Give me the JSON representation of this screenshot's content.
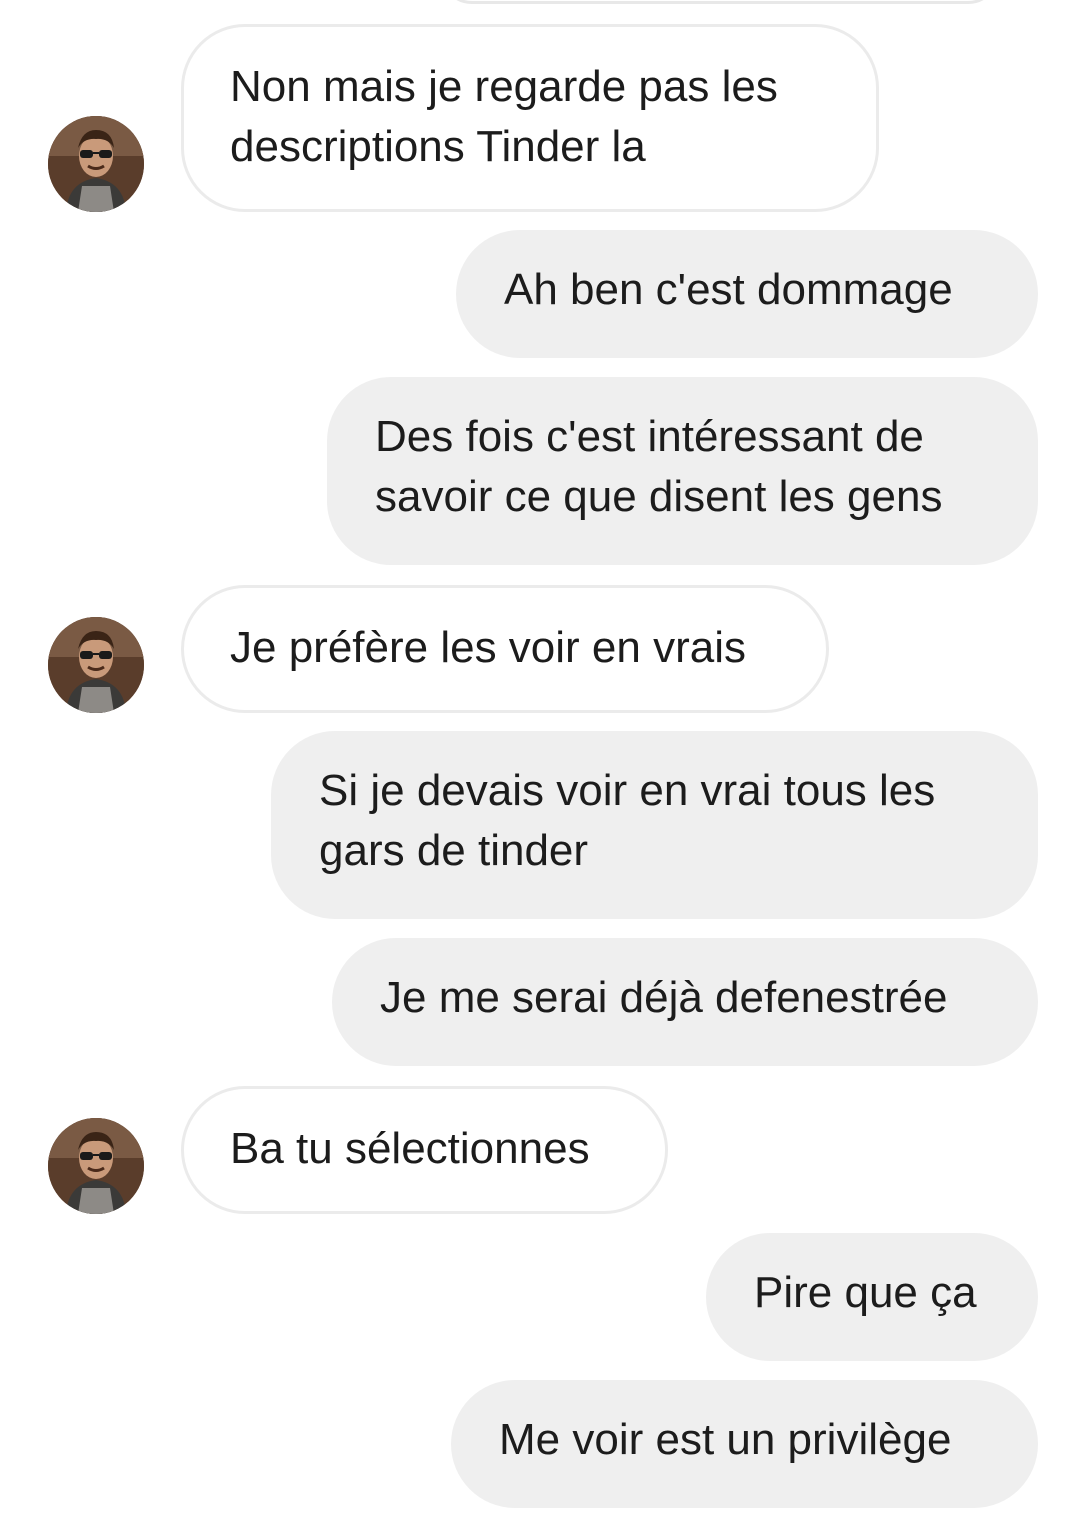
{
  "conversation": {
    "messages": [
      {
        "sender": "other",
        "text": "Non mais je regarde pas les\ndescriptions Tinder la"
      },
      {
        "sender": "me",
        "text": "Ah ben c'est dommage"
      },
      {
        "sender": "me",
        "text": "Des fois c'est intéressant de\nsavoir ce que disent les gens"
      },
      {
        "sender": "other",
        "text": "Je préfère les voir en vrais"
      },
      {
        "sender": "me",
        "text": "Si je devais voir en vrai tous les\ngars de tinder"
      },
      {
        "sender": "me",
        "text": "Je me serai déjà defenestrée"
      },
      {
        "sender": "other",
        "text": "Ba tu sélectionnes"
      },
      {
        "sender": "me",
        "text": "Pire que ça"
      },
      {
        "sender": "me",
        "text": "Me voir est un privilège"
      }
    ]
  },
  "colors": {
    "incoming_bubble_bg": "#ffffff",
    "incoming_bubble_border": "#ebebeb",
    "outgoing_bubble_bg": "#efefef",
    "text": "#1c1c1c"
  },
  "icons": {
    "avatar": "contact-avatar-photo"
  }
}
